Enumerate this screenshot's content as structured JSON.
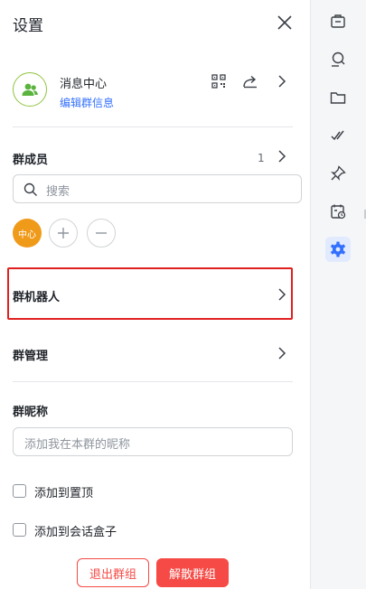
{
  "header": {
    "title": "设置"
  },
  "group": {
    "name": "消息中心",
    "edit_label": "编辑群信息"
  },
  "members": {
    "title": "群成员",
    "count": "1",
    "search_placeholder": "搜索",
    "list": [
      {
        "label": "中心"
      }
    ]
  },
  "bots": {
    "title": "群机器人"
  },
  "management": {
    "title": "群管理"
  },
  "nickname": {
    "title": "群昵称",
    "placeholder": "添加我在本群的昵称"
  },
  "options": {
    "pin_label": "添加到置顶",
    "box_label": "添加到会话盒子"
  },
  "actions": {
    "exit_label": "退出群组",
    "dissolve_label": "解散群组"
  },
  "sidebar": {
    "icons": [
      "announcement-icon",
      "search-history-icon",
      "folder-icon",
      "tasks-icon",
      "pin-icon",
      "calendar-icon",
      "settings-icon"
    ],
    "active": "settings-icon"
  },
  "colors": {
    "accent": "#3370ff",
    "danger": "#f54a45",
    "highlight_border": "#e02020",
    "avatar": "#f09a1a"
  }
}
